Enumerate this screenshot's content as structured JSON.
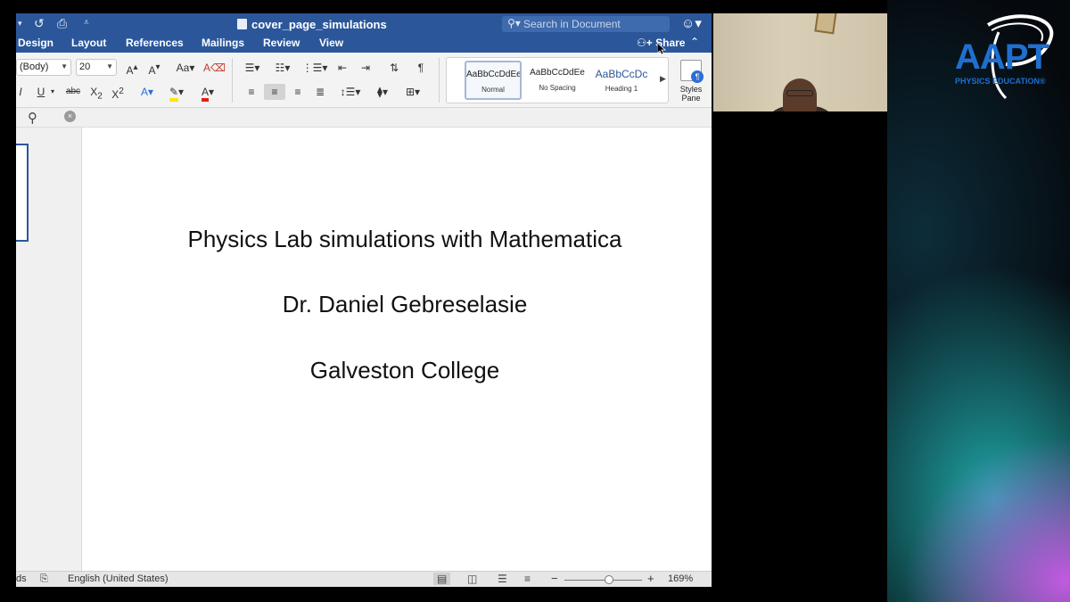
{
  "titlebar": {
    "doc_title": "cover_page_simulations",
    "search_placeholder": "Search in Document"
  },
  "ribbon_tabs": [
    "Design",
    "Layout",
    "References",
    "Mailings",
    "Review",
    "View"
  ],
  "share_label": "Share",
  "font": {
    "name": "(Body)",
    "size": "20"
  },
  "styles": [
    {
      "sample": "AaBbCcDdEe",
      "name": "Normal"
    },
    {
      "sample": "AaBbCcDdEe",
      "name": "No Spacing"
    },
    {
      "sample": "AaBbCcDc",
      "name": "Heading 1"
    }
  ],
  "styles_pane_label_1": "Styles",
  "styles_pane_label_2": "Pane",
  "document": {
    "line1": "Physics Lab simulations with Mathematica",
    "line2": "Dr. Daniel Gebreselasie",
    "line3": "Galveston College"
  },
  "status": {
    "words_fragment": "ds",
    "language": "English (United States)",
    "zoom": "169%"
  },
  "logo": {
    "main": "AAPT",
    "sub": "PHYSICS EDUCATION®"
  },
  "colors": {
    "word_blue": "#2b579a",
    "aapt_blue": "#1f6fd0"
  },
  "icons": {
    "undo": "undo-icon",
    "print": "print-icon",
    "search": "search-icon",
    "smiley": "feedback-smiley-icon",
    "share": "add-person-icon",
    "collapse": "chevron-up-icon"
  }
}
